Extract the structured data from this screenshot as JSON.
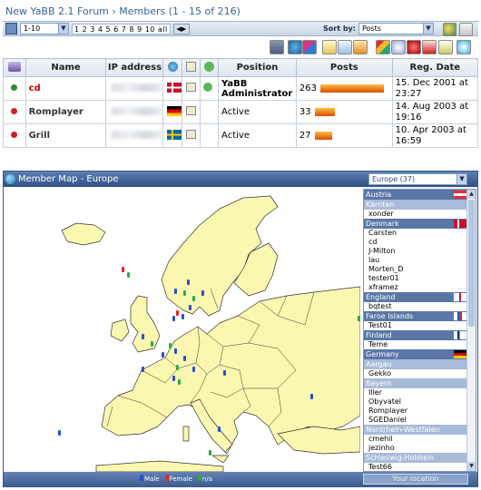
{
  "breadcrumb": {
    "forum": "New YaBB 2.1 Forum",
    "separator": "›",
    "section": "Members (1 - 15 of 216)"
  },
  "toolbar": {
    "per_page": "1-10",
    "pages": "1 2 3 4 5 6 7 8 9 10 all",
    "sort_label": "Sort by:",
    "sort_value": "Posts"
  },
  "columns": [
    "Name",
    "IP address",
    "Position",
    "Posts",
    "Reg. Date"
  ],
  "members": [
    {
      "name": "cd",
      "name_color": "#cc0000",
      "status_color": "#2e8b2e",
      "flag": "Denmark",
      "online": true,
      "position": "YaBB Administrator",
      "posts": "263",
      "posts_bar": 1.0,
      "reg_date": "15. Dec 2001 at 23:27"
    },
    {
      "name": "Romplayer",
      "name_color": "#333333",
      "status_color": "#cc2222",
      "flag": "Germany",
      "online": false,
      "position": "Active",
      "posts": "33",
      "posts_bar": 0.32,
      "reg_date": "14. Aug 2003 at 19:16"
    },
    {
      "name": "Grill",
      "name_color": "#333333",
      "status_color": "#cc2222",
      "flag": "Sweden",
      "online": false,
      "position": "Active",
      "posts": "27",
      "posts_bar": 0.27,
      "reg_date": "10. Apr 2003 at 16:59"
    }
  ],
  "member_map": {
    "title": "Member Map - Europe",
    "region_select": "Europe (37)",
    "legend": {
      "male": "Male",
      "female": "Female",
      "na": "n/a"
    },
    "your_location": "Your location",
    "list": [
      {
        "type": "country",
        "label": "Austria",
        "flag": "austria"
      },
      {
        "type": "region",
        "label": "Kärnten"
      },
      {
        "type": "member",
        "label": "xonder"
      },
      {
        "type": "country",
        "label": "Denmark",
        "flag": "denmark"
      },
      {
        "type": "member",
        "label": "Carsten"
      },
      {
        "type": "member",
        "label": "cd"
      },
      {
        "type": "member",
        "label": "J-Milton"
      },
      {
        "type": "member",
        "label": "lau"
      },
      {
        "type": "member",
        "label": "Morten_D"
      },
      {
        "type": "member",
        "label": "tester01"
      },
      {
        "type": "member",
        "label": "xframez"
      },
      {
        "type": "country",
        "label": "England",
        "flag": "england"
      },
      {
        "type": "member",
        "label": "bqtest"
      },
      {
        "type": "country",
        "label": "Faroe Islands",
        "flag": "faroe"
      },
      {
        "type": "member",
        "label": "Test01"
      },
      {
        "type": "country",
        "label": "Finland",
        "flag": "finland"
      },
      {
        "type": "member",
        "label": "Teme"
      },
      {
        "type": "country",
        "label": "Germany",
        "flag": "germany"
      },
      {
        "type": "region",
        "label": "Aargau"
      },
      {
        "type": "member",
        "label": "Gekko"
      },
      {
        "type": "region",
        "label": "Bayern"
      },
      {
        "type": "member",
        "label": "Iller"
      },
      {
        "type": "member",
        "label": "Obyvatel"
      },
      {
        "type": "member",
        "label": "Romplayer"
      },
      {
        "type": "member",
        "label": "SGEDaniel"
      },
      {
        "type": "region",
        "label": "Nordrhein-Westfalen"
      },
      {
        "type": "member",
        "label": "cmehil"
      },
      {
        "type": "member",
        "label": "jezinho"
      },
      {
        "type": "region",
        "label": "Schleswig-Holstein"
      },
      {
        "type": "member",
        "label": "Test66"
      }
    ]
  },
  "colors": {
    "link": "#35669a",
    "map_land": "#fbf7b0",
    "map_border": "#333333",
    "header_blue": "#3a5b8c"
  }
}
